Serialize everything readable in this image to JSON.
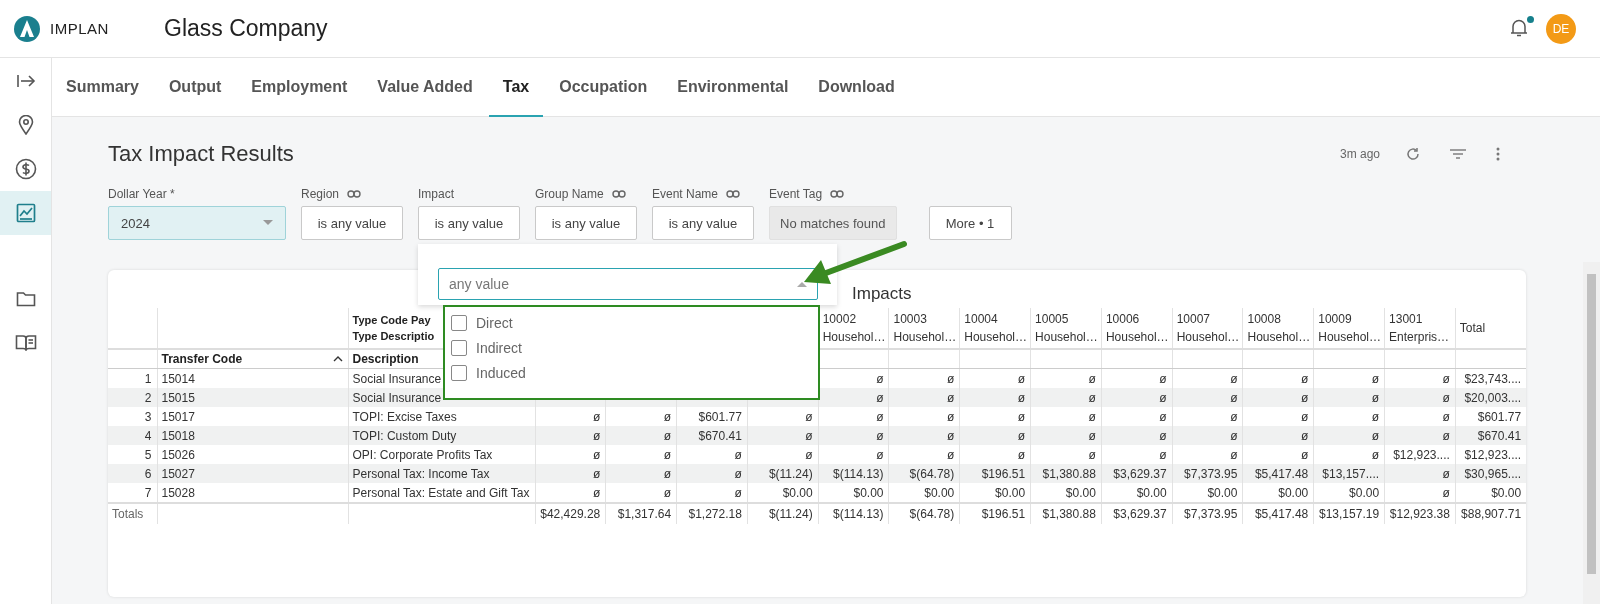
{
  "app": {
    "logo_text": "IMPLAN",
    "project_title": "Glass Company",
    "notification_dot": true,
    "avatar_initials": "DE"
  },
  "sidebar": {
    "items": [
      {
        "kind": "expand",
        "selected": false
      },
      {
        "kind": "location",
        "selected": false
      },
      {
        "kind": "dollar",
        "selected": false
      },
      {
        "kind": "chart",
        "selected": true
      },
      {
        "kind": "folder",
        "selected": false
      },
      {
        "kind": "book",
        "selected": false
      }
    ]
  },
  "tabs": [
    {
      "label": "Summary",
      "selected": false
    },
    {
      "label": "Output",
      "selected": false
    },
    {
      "label": "Employment",
      "selected": false
    },
    {
      "label": "Value Added",
      "selected": false
    },
    {
      "label": "Tax",
      "selected": true
    },
    {
      "label": "Occupation",
      "selected": false
    },
    {
      "label": "Environmental",
      "selected": false
    },
    {
      "label": "Download",
      "selected": false
    }
  ],
  "page": {
    "title": "Tax Impact Results",
    "updated": "3m ago"
  },
  "filters": [
    {
      "kind": "select",
      "label": "Dollar Year *",
      "value": "2024",
      "linked": false,
      "disabled": false
    },
    {
      "kind": "text",
      "label": "Region",
      "value": "is any value",
      "linked": true,
      "disabled": false
    },
    {
      "kind": "text",
      "label": "Impact",
      "value": "is any value",
      "linked": false,
      "disabled": false
    },
    {
      "kind": "text",
      "label": "Group Name",
      "value": "is any value",
      "linked": true,
      "disabled": false
    },
    {
      "kind": "text",
      "label": "Event Name",
      "value": "is any value",
      "linked": true,
      "disabled": false
    },
    {
      "kind": "text",
      "label": "Event Tag",
      "value": "No matches found",
      "linked": true,
      "disabled": true
    }
  ],
  "more_button": "More • 1",
  "impact_dropdown": {
    "placeholder": "any value",
    "options": [
      {
        "label": "Direct",
        "checked": false
      },
      {
        "label": "Indirect",
        "checked": false
      },
      {
        "label": "Induced",
        "checked": false
      }
    ]
  },
  "table": {
    "title": "Impacts",
    "transfer_header": "Transfer Code",
    "sorted_ascending": true,
    "description_header": "Description",
    "description_group_lines": [
      "Type Code Pay",
      "Type Descriptio"
    ],
    "value_columns": [
      {},
      {},
      {},
      {},
      {
        "code": "10002",
        "name": "Househol…"
      },
      {
        "code": "10003",
        "name": "Househol…"
      },
      {
        "code": "10004",
        "name": "Househol…"
      },
      {
        "code": "10005",
        "name": "Househol…"
      },
      {
        "code": "10006",
        "name": "Househol…"
      },
      {
        "code": "10007",
        "name": "Househol…"
      },
      {
        "code": "10008",
        "name": "Househol…"
      },
      {
        "code": "10009",
        "name": "Househol…"
      },
      {
        "code": "13001",
        "name": "Enterpris…"
      },
      {
        "name": "Total"
      }
    ],
    "rows": [
      {
        "number": "1",
        "transfer_code": "15014",
        "description": "Social Insurance",
        "values": [
          "ø",
          "ø",
          "ø",
          "ø",
          "ø",
          "ø",
          "ø",
          "ø",
          "ø",
          "$23,743...."
        ]
      },
      {
        "number": "2",
        "transfer_code": "15015",
        "description": "Social Insurance",
        "values": [
          "ø",
          "ø",
          "ø",
          "ø",
          "ø",
          "ø",
          "ø",
          "ø",
          "ø",
          "$20,003...."
        ]
      },
      {
        "number": "3",
        "transfer_code": "15017",
        "description": "TOPI: Excise Taxes",
        "values": [
          "ø",
          "ø",
          "$601.77",
          "ø",
          "ø",
          "ø",
          "ø",
          "ø",
          "ø",
          "ø",
          "ø",
          "ø",
          "ø",
          "$601.77"
        ]
      },
      {
        "number": "4",
        "transfer_code": "15018",
        "description": "TOPI: Custom Duty",
        "values": [
          "ø",
          "ø",
          "$670.41",
          "ø",
          "ø",
          "ø",
          "ø",
          "ø",
          "ø",
          "ø",
          "ø",
          "ø",
          "ø",
          "$670.41"
        ]
      },
      {
        "number": "5",
        "transfer_code": "15026",
        "description": "OPI: Corporate Profits Tax",
        "values": [
          "ø",
          "ø",
          "ø",
          "ø",
          "ø",
          "ø",
          "ø",
          "ø",
          "ø",
          "ø",
          "ø",
          "ø",
          "$12,923....",
          "$12,923...."
        ]
      },
      {
        "number": "6",
        "transfer_code": "15027",
        "description": "Personal Tax: Income Tax",
        "values": [
          "ø",
          "ø",
          "ø",
          "$(11.24)",
          "$(114.13)",
          "$(64.78)",
          "$196.51",
          "$1,380.88",
          "$3,629.37",
          "$7,373.95",
          "$5,417.48",
          "$13,157....",
          "ø",
          "$30,965...."
        ]
      },
      {
        "number": "7",
        "transfer_code": "15028",
        "description": "Personal Tax: Estate and Gift Tax",
        "values": [
          "ø",
          "ø",
          "ø",
          "$0.00",
          "$0.00",
          "$0.00",
          "$0.00",
          "$0.00",
          "$0.00",
          "$0.00",
          "$0.00",
          "$0.00",
          "ø",
          "$0.00"
        ]
      }
    ],
    "totals": {
      "label": "Totals",
      "values": [
        "$42,429.28",
        "$1,317.64",
        "$1,272.18",
        "$(11.24)",
        "$(114.13)",
        "$(64.78)",
        "$196.51",
        "$1,380.88",
        "$3,629.37",
        "$7,373.95",
        "$5,417.48",
        "$13,157.19",
        "$12,923.38",
        "$88,907.71"
      ]
    }
  }
}
